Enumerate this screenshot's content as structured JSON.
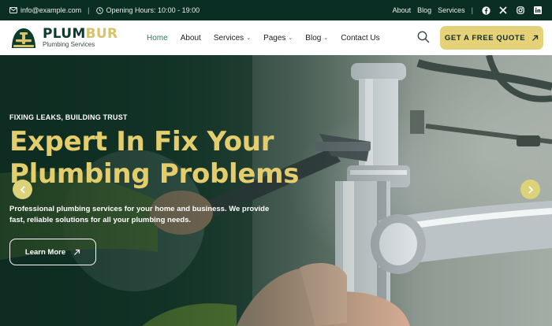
{
  "topbar": {
    "email": "info@example.com",
    "hours": "Opening Hours: 10:00 - 19:00",
    "links": [
      "About",
      "Blog",
      "Services"
    ],
    "social_icons": [
      "facebook-icon",
      "x-icon",
      "instagram-icon",
      "linkedin-icon"
    ]
  },
  "brand": {
    "name_part1": "PLUM",
    "name_part2": "BUR",
    "tagline": "Plumbing Services",
    "colors": {
      "dark": "#0d3b2e",
      "accent": "#d8c36a"
    }
  },
  "nav": {
    "items": [
      {
        "label": "Home",
        "active": true,
        "dropdown": false
      },
      {
        "label": "About",
        "active": false,
        "dropdown": false
      },
      {
        "label": "Services",
        "active": false,
        "dropdown": true
      },
      {
        "label": "Pages",
        "active": false,
        "dropdown": true
      },
      {
        "label": "Blog",
        "active": false,
        "dropdown": true
      },
      {
        "label": "Contact Us",
        "active": false,
        "dropdown": false
      }
    ],
    "cta_label": "GET A FREE QUOTE"
  },
  "hero": {
    "eyebrow": "FIXING LEAKS, BUILDING TRUST",
    "headline_line1": "Expert In Fix Your",
    "headline_line2": "Plumbing Problems",
    "description": "Professional plumbing services for your home and business. We provide fast, reliable solutions for all your plumbing needs.",
    "button_label": "Learn More",
    "accent_color": "#e3cd6c"
  }
}
